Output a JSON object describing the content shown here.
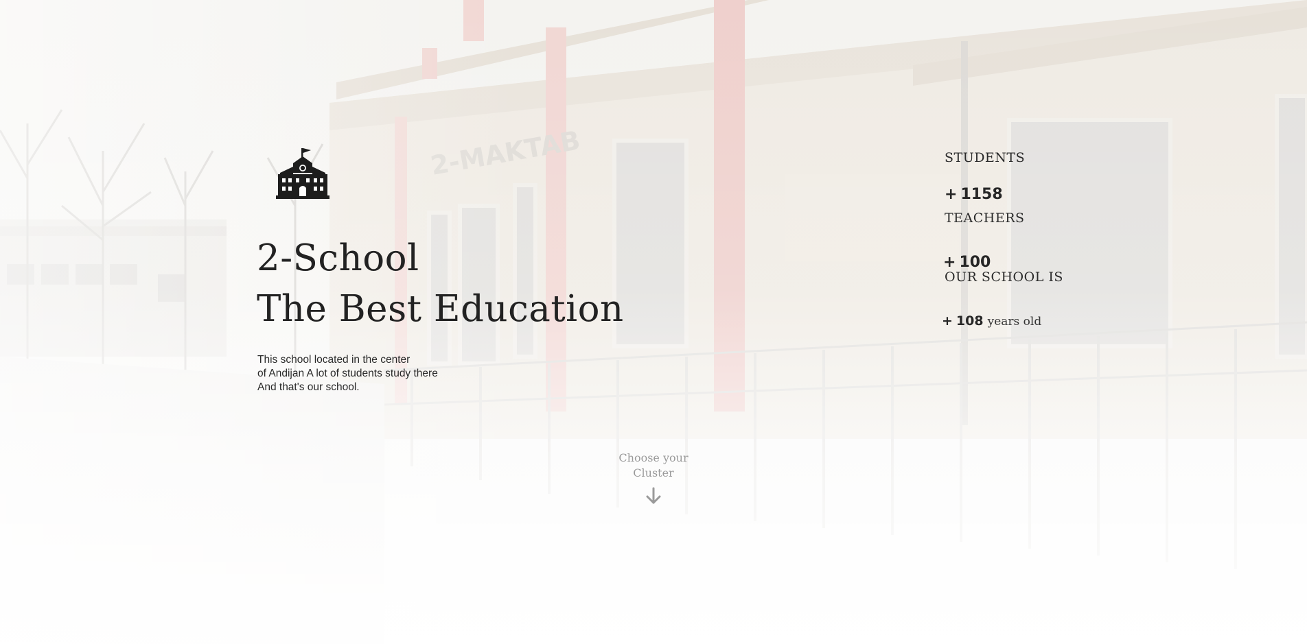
{
  "hero": {
    "logo_icon": "school-building-icon",
    "title_line1": "2-School",
    "title_line2": "The Best Education",
    "description_line1": "This school located in the center",
    "description_line2": "of Andijan A lot of students study there",
    "description_line3": "And that's our school."
  },
  "stats": {
    "students": {
      "label": "STUDENTS",
      "prefix": "+",
      "value": "1158"
    },
    "teachers": {
      "label": "TEACHERS",
      "prefix": "+",
      "value": "100"
    },
    "age": {
      "label": "OUR SCHOOL IS",
      "prefix": "+",
      "value": "108",
      "suffix": "years old"
    }
  },
  "cta": {
    "line1": "Choose your",
    "line2": "Cluster",
    "icon": "arrow-down-icon"
  },
  "colors": {
    "text_primary": "#222222",
    "text_muted": "#9a9a9a",
    "accent_red": "#e58a8a",
    "background": "#f6f5f2"
  }
}
